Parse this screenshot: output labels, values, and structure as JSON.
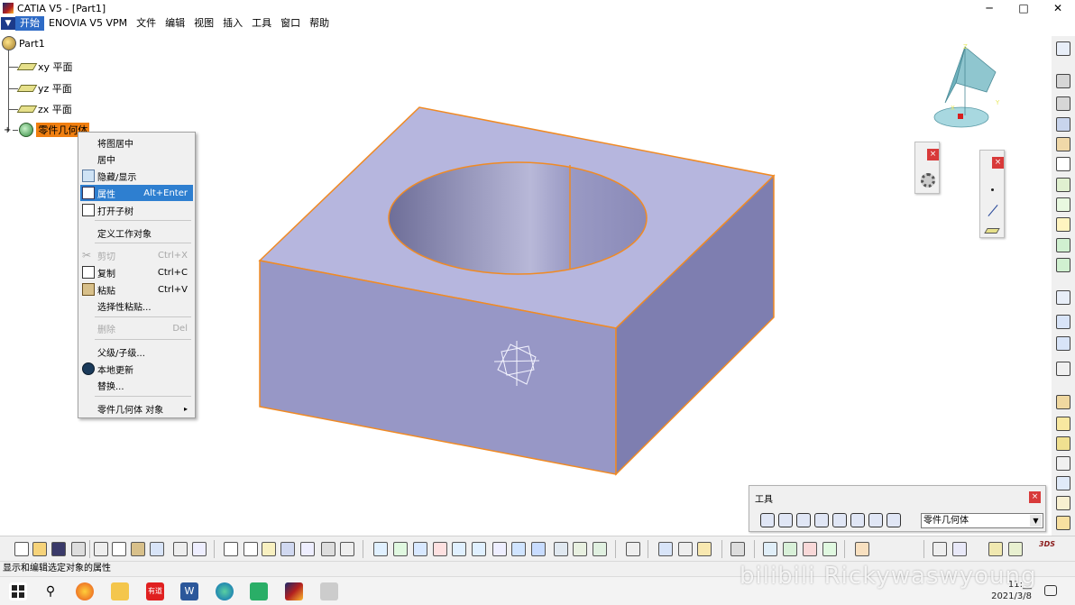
{
  "window": {
    "title": "CATIA V5 - [Part1]",
    "controls": {
      "minimize": "─",
      "maximize": "□",
      "close": "✕"
    }
  },
  "menubar": {
    "items": [
      "开始",
      "ENOVIA V5 VPM",
      "文件",
      "编辑",
      "视图",
      "插入",
      "工具",
      "窗口",
      "帮助"
    ]
  },
  "tree": {
    "root": "Part1",
    "items": [
      {
        "label": "xy 平面",
        "icon": "plane-icon"
      },
      {
        "label": "yz 平面",
        "icon": "plane-icon"
      },
      {
        "label": "zx 平面",
        "icon": "plane-icon"
      },
      {
        "label": "零件几何体",
        "icon": "body-icon"
      }
    ]
  },
  "context_menu": {
    "items": [
      {
        "label": "将图居中",
        "shortcut": ""
      },
      {
        "label": "居中",
        "shortcut": ""
      },
      {
        "label": "隐藏/显示",
        "shortcut": ""
      },
      {
        "label": "属性",
        "shortcut": "Alt+Enter"
      },
      {
        "label": "打开子树",
        "shortcut": ""
      },
      {
        "label": "定义工作对象",
        "shortcut": ""
      },
      {
        "label": "剪切",
        "shortcut": "Ctrl+X"
      },
      {
        "label": "复制",
        "shortcut": "Ctrl+C"
      },
      {
        "label": "粘贴",
        "shortcut": "Ctrl+V"
      },
      {
        "label": "选择性粘贴...",
        "shortcut": ""
      },
      {
        "label": "删除",
        "shortcut": "Del"
      },
      {
        "label": "父级/子级...",
        "shortcut": ""
      },
      {
        "label": "本地更新",
        "shortcut": ""
      },
      {
        "label": "替换...",
        "shortcut": ""
      },
      {
        "label": "零件几何体 对象",
        "shortcut": ""
      }
    ],
    "highlighted": "属性",
    "disabled": [
      "剪切",
      "删除"
    ]
  },
  "compass": {
    "axis_x": "X",
    "axis_y": "Y",
    "axis_z": "Z"
  },
  "tools_panel": {
    "title": "工具",
    "current_body": "零件几何体",
    "close": "×"
  },
  "float_boxes": {
    "close": "×"
  },
  "status": {
    "text": "显示和编辑选定对象的属性"
  },
  "taskbar": {
    "time": "11:__",
    "date": "2021/3/8",
    "app_label": "有道"
  },
  "watermark": "bilibili Rickywaswyoung",
  "colors": {
    "accent": "#2e6bc6",
    "body_highlight": "#f07f10",
    "solid_top": "#b4b4dc",
    "solid_front": "#8c8cbf",
    "solid_side": "#7b7bad",
    "edge": "#f08a24"
  }
}
